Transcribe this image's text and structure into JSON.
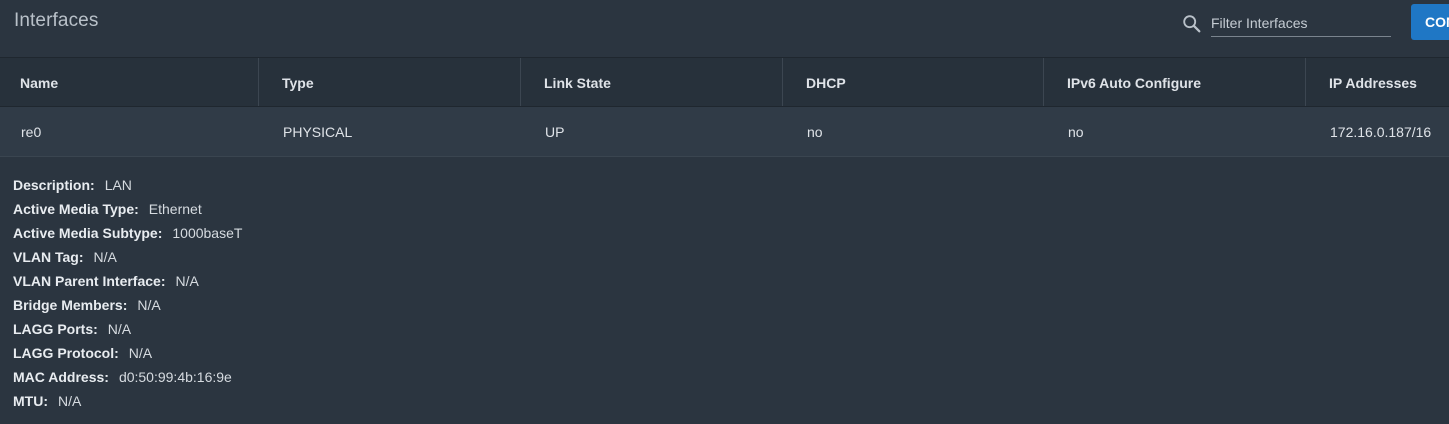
{
  "toolbar": {
    "title": "Interfaces",
    "search_icon": "search-icon",
    "filter_placeholder": "Filter Interfaces",
    "action_button_label": "CONFIGURE"
  },
  "table": {
    "columns": [
      "Name",
      "Type",
      "Link State",
      "DHCP",
      "IPv6 Auto Configure",
      "IP Addresses"
    ],
    "rows": [
      [
        "re0",
        "PHYSICAL",
        "UP",
        "no",
        "no",
        "172.16.0.187/16"
      ]
    ]
  },
  "details": [
    {
      "label": "Description:",
      "value": "LAN"
    },
    {
      "label": "Active Media Type:",
      "value": "Ethernet"
    },
    {
      "label": "Active Media Subtype:",
      "value": "1000baseT"
    },
    {
      "label": "VLAN Tag:",
      "value": "N/A"
    },
    {
      "label": "VLAN Parent Interface:",
      "value": "N/A"
    },
    {
      "label": "Bridge Members:",
      "value": "N/A"
    },
    {
      "label": "LAGG Ports:",
      "value": "N/A"
    },
    {
      "label": "LAGG Protocol:",
      "value": "N/A"
    },
    {
      "label": "MAC Address:",
      "value": "d0:50:99:4b:16:9e"
    },
    {
      "label": "MTU:",
      "value": "N/A"
    }
  ],
  "colors": {
    "background": "#2b3540",
    "header_background": "#27313b",
    "row_background": "#303b47",
    "accent": "#1f77c5"
  }
}
